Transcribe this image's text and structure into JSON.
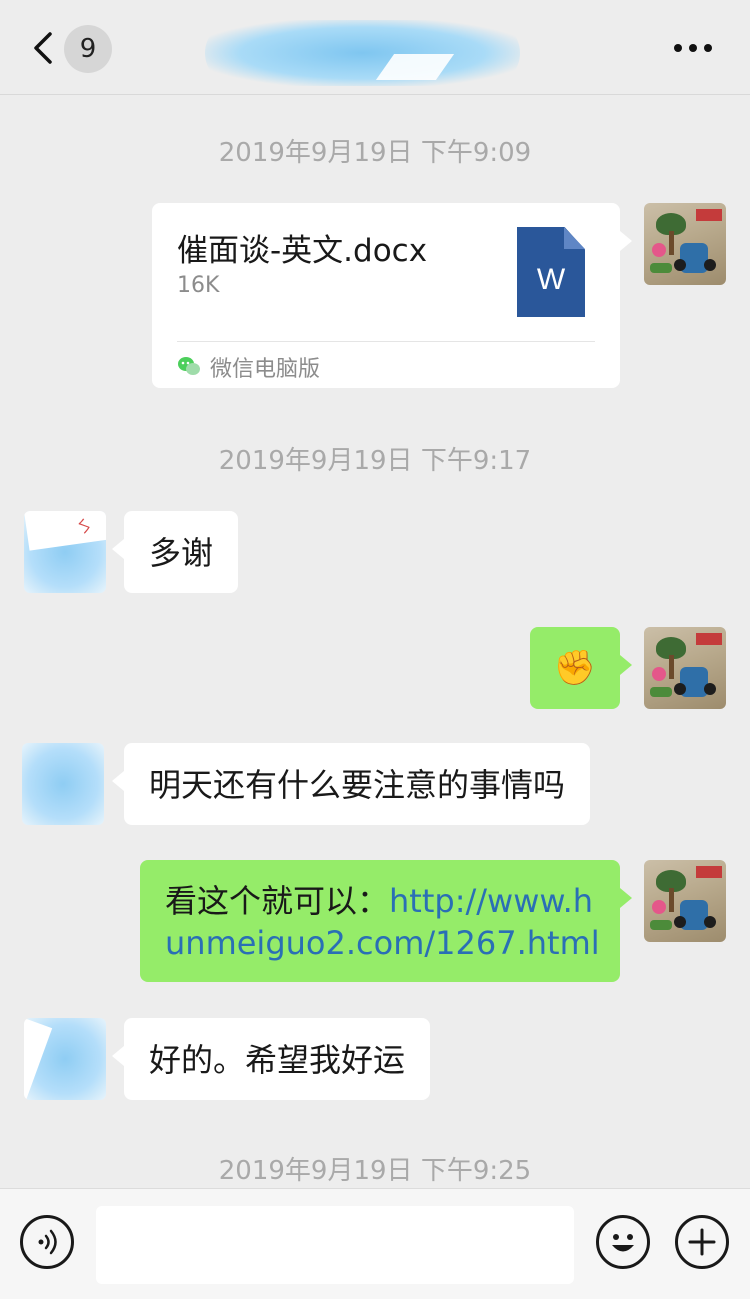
{
  "header": {
    "unread_count": "9"
  },
  "timestamps": [
    "2019年9月19日 下午9:09",
    "2019年9月19日 下午9:17",
    "2019年9月19日 下午9:25"
  ],
  "messages": [
    {
      "type": "file",
      "file_name": "催面谈-英文.docx",
      "file_size": "16K",
      "file_icon_label": "W",
      "source": "微信电脑版"
    },
    {
      "type": "text",
      "text": "多谢"
    },
    {
      "type": "emoji",
      "emoji": "✊"
    },
    {
      "type": "text",
      "text": "明天还有什么要注意的事情吗"
    },
    {
      "type": "text",
      "text_prefix": "看这个就可以：",
      "link_line1": "http://www.h",
      "link_line2": "unmeiguo2.com/1267.html"
    },
    {
      "type": "text",
      "text": "好的。希望我好运"
    }
  ],
  "input": {
    "value": ""
  },
  "colors": {
    "background": "#ededed",
    "outgoing_bubble": "#95ec69",
    "incoming_bubble": "#ffffff",
    "link": "#2a6fb5",
    "timestamp": "#a9a9a9"
  },
  "icons": [
    "back-arrow-icon",
    "more-icon",
    "word-doc-icon",
    "wechat-logo-icon",
    "voice-icon",
    "emoji-icon",
    "plus-icon"
  ]
}
